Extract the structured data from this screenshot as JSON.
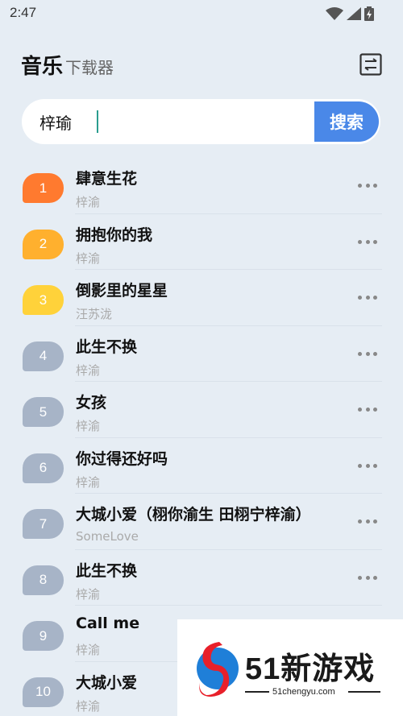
{
  "status": {
    "time": "2:47"
  },
  "header": {
    "title": "音乐",
    "subtitle": "下载器",
    "menu_icon": "list-toggle-icon"
  },
  "search": {
    "value": "梓瑜",
    "button_label": "搜索"
  },
  "colors": {
    "badge_1": "#ff7a2f",
    "badge_2": "#ffb02e",
    "badge_3": "#ffd23a",
    "badge_rest": "#a7b4c7",
    "search_button": "#4a88e8"
  },
  "songs": [
    {
      "rank": "1",
      "title": "肆意生花",
      "artist": "梓渝"
    },
    {
      "rank": "2",
      "title": "拥抱你的我",
      "artist": "梓渝"
    },
    {
      "rank": "3",
      "title": "倒影里的星星",
      "artist": "汪苏泷"
    },
    {
      "rank": "4",
      "title": "此生不换",
      "artist": "梓渝"
    },
    {
      "rank": "5",
      "title": "女孩",
      "artist": "梓渝"
    },
    {
      "rank": "6",
      "title": "你过得还好吗",
      "artist": "梓渝"
    },
    {
      "rank": "7",
      "title": "大城小爱（栩你渝生 田栩宁梓渝）",
      "artist": "SomeLove"
    },
    {
      "rank": "8",
      "title": "此生不换",
      "artist": "梓渝"
    },
    {
      "rank": "9",
      "title": "Call me",
      "artist": "梓渝"
    },
    {
      "rank": "10",
      "title": "大城小爱",
      "artist": "梓渝"
    }
  ],
  "watermark": {
    "text": "51新游戏",
    "url": "51chengyu.com"
  }
}
